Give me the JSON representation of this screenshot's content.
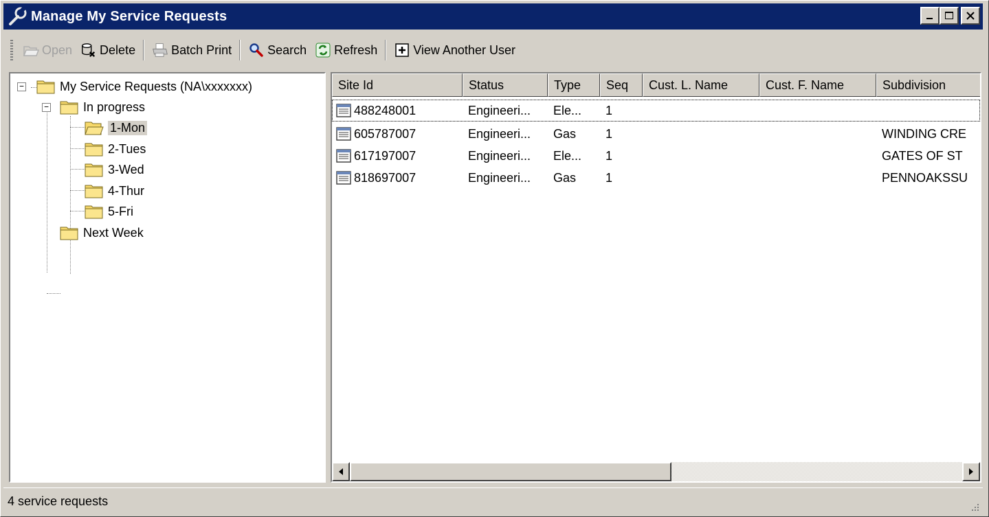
{
  "window": {
    "title": "Manage My Service Requests",
    "icon": "wrench-icon",
    "caption_buttons": [
      "minimize",
      "maximize",
      "close"
    ]
  },
  "toolbar": {
    "open_label": "Open",
    "delete_label": "Delete",
    "batch_print_label": "Batch Print",
    "search_label": "Search",
    "refresh_label": "Refresh",
    "view_another_user_label": "View Another User"
  },
  "tree": {
    "root": "My Service Requests (NA\\xxxxxxx)",
    "in_progress": "In progress",
    "days": [
      "1-Mon",
      "2-Tues",
      "3-Wed",
      "4-Thur",
      "5-Fri"
    ],
    "next_week": "Next Week",
    "selected": "1-Mon"
  },
  "list": {
    "columns": [
      "Site Id",
      "Status",
      "Type",
      "Seq",
      "Cust. L. Name",
      "Cust. F. Name",
      "Subdivision"
    ],
    "rows": [
      {
        "site_id": "488248001",
        "status": "Engineeri...",
        "type": "Ele...",
        "seq": "1",
        "cust_l": "",
        "cust_f": "",
        "subdivision": ""
      },
      {
        "site_id": "605787007",
        "status": "Engineeri...",
        "type": "Gas",
        "seq": "1",
        "cust_l": "",
        "cust_f": "",
        "subdivision": "WINDING CRE"
      },
      {
        "site_id": "617197007",
        "status": "Engineeri...",
        "type": "Ele...",
        "seq": "1",
        "cust_l": "",
        "cust_f": "",
        "subdivision": "GATES OF ST"
      },
      {
        "site_id": "818697007",
        "status": "Engineeri...",
        "type": "Gas",
        "seq": "1",
        "cust_l": "",
        "cust_f": "",
        "subdivision": "PENNOAKSSU"
      }
    ]
  },
  "status": {
    "text": "4 service requests"
  },
  "colors": {
    "titlebar": "#0a246a",
    "face": "#d4d0c8",
    "folder": "#f7d96b"
  }
}
